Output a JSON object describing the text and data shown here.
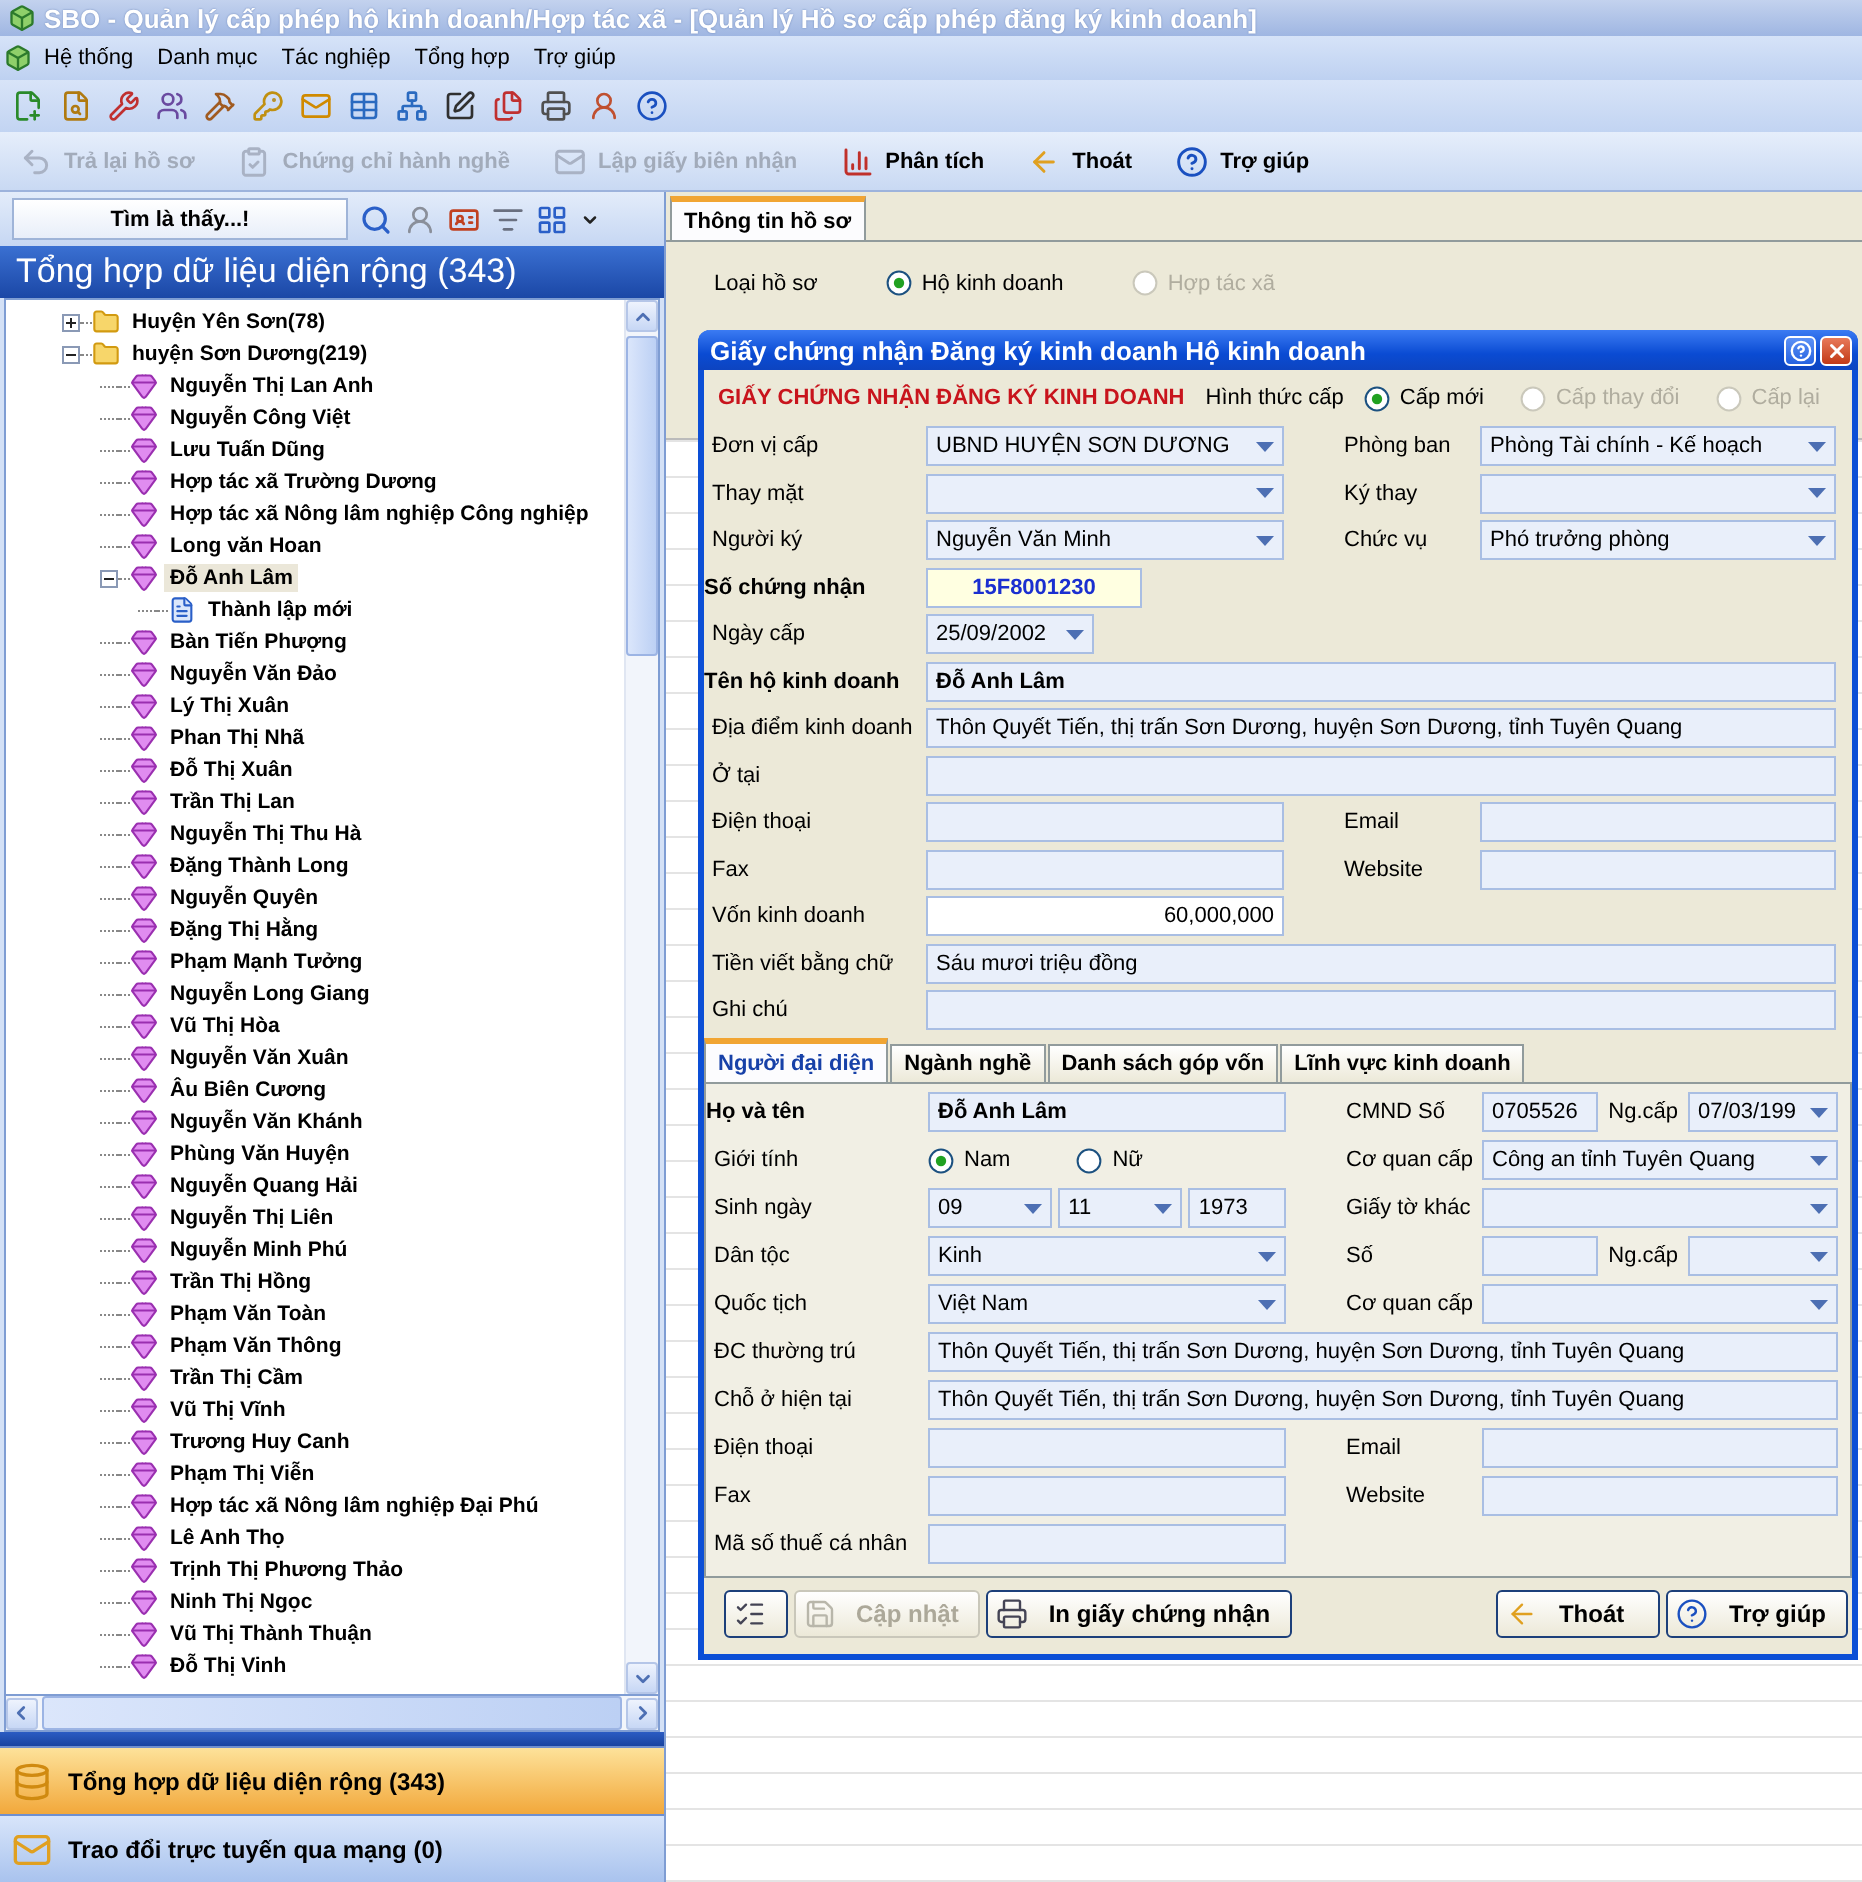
{
  "window": {
    "title": "SBO - Quản lý cấp phép hộ kinh doanh/Hợp tác xã - [Quản lý Hồ sơ cấp phép đăng ký kinh doanh]"
  },
  "menu": [
    "Hệ thống",
    "Danh mục",
    "Tác nghiệp",
    "Tổng hợp",
    "Trợ giúp"
  ],
  "commands": [
    {
      "label": "Trả lại hồ sơ",
      "disabled": true
    },
    {
      "label": "Chứng chỉ hành nghề",
      "disabled": true
    },
    {
      "label": "Lập giấy biên nhận",
      "disabled": true
    },
    {
      "label": "Phân tích",
      "disabled": false
    },
    {
      "label": "Thoát",
      "disabled": false
    },
    {
      "label": "Trợ giúp",
      "disabled": false
    }
  ],
  "sidebar": {
    "search_button": "Tìm là thấy...!",
    "header": "Tổng hợp dữ liệu diện rộng (343)",
    "tree": [
      {
        "label": "Huyện Yên Sơn(78)",
        "kind": "group",
        "selected": false,
        "expanded": false
      },
      {
        "label": "huyện Sơn Dương(219)",
        "kind": "group",
        "selected": false,
        "expanded": true,
        "children": [
          {
            "label": "Nguyễn Thị Lan Anh",
            "kind": "person",
            "selected": false
          },
          {
            "label": "Nguyễn Công Việt",
            "kind": "person",
            "selected": false
          },
          {
            "label": "Lưu Tuấn Dũng",
            "kind": "person",
            "selected": false
          },
          {
            "label": "Hợp tác xã Trường Dương",
            "kind": "person",
            "selected": false
          },
          {
            "label": "Hợp tác xã Nông lâm nghiệp Công nghiệp",
            "kind": "person",
            "selected": false
          },
          {
            "label": "Long văn Hoan",
            "kind": "person",
            "selected": false
          },
          {
            "label": "Đỗ Anh Lâm",
            "kind": "person",
            "selected": true,
            "expanded": true,
            "children": [
              {
                "label": "Thành lập mới",
                "kind": "record",
                "selected": false
              }
            ]
          },
          {
            "label": "Bàn Tiến Phượng",
            "kind": "person",
            "selected": false
          },
          {
            "label": "Nguyễn Văn Đảo",
            "kind": "person",
            "selected": false
          },
          {
            "label": "Lý Thị Xuân",
            "kind": "person",
            "selected": false
          },
          {
            "label": "Phan Thị Nhã",
            "kind": "person",
            "selected": false
          },
          {
            "label": "Đỗ Thị Xuân",
            "kind": "person",
            "selected": false
          },
          {
            "label": "Trần Thị Lan",
            "kind": "person",
            "selected": false
          },
          {
            "label": "Nguyễn Thị Thu Hà",
            "kind": "person",
            "selected": false
          },
          {
            "label": "Đặng Thành Long",
            "kind": "person",
            "selected": false
          },
          {
            "label": "Nguyễn Quyên",
            "kind": "person",
            "selected": false
          },
          {
            "label": "Đặng Thị Hằng",
            "kind": "person",
            "selected": false
          },
          {
            "label": "Phạm Mạnh Tưởng",
            "kind": "person",
            "selected": false
          },
          {
            "label": "Nguyễn Long Giang",
            "kind": "person",
            "selected": false
          },
          {
            "label": "Vũ Thị Hòa",
            "kind": "person",
            "selected": false
          },
          {
            "label": "Nguyễn Văn Xuân",
            "kind": "person",
            "selected": false
          },
          {
            "label": "Âu Biên Cương",
            "kind": "person",
            "selected": false
          },
          {
            "label": "Nguyễn Văn Khánh",
            "kind": "person",
            "selected": false
          },
          {
            "label": "Phùng Văn Huyện",
            "kind": "person",
            "selected": false
          },
          {
            "label": "Nguyễn Quang Hải",
            "kind": "person",
            "selected": false
          },
          {
            "label": "Nguyễn Thị Liên",
            "kind": "person",
            "selected": false
          },
          {
            "label": "Nguyễn Minh Phú",
            "kind": "person",
            "selected": false
          },
          {
            "label": "Trần Thị Hồng",
            "kind": "person",
            "selected": false
          },
          {
            "label": "Phạm Văn Toàn",
            "kind": "person",
            "selected": false
          },
          {
            "label": "Phạm Văn Thông",
            "kind": "person",
            "selected": false
          },
          {
            "label": "Trần Thị Cầm",
            "kind": "person",
            "selected": false
          },
          {
            "label": "Vũ Thị Vĩnh",
            "kind": "person",
            "selected": false
          },
          {
            "label": "Trương Huy Canh",
            "kind": "person",
            "selected": false
          },
          {
            "label": "Phạm Thị Viễn",
            "kind": "person",
            "selected": false
          },
          {
            "label": "Hợp tác xã Nông lâm nghiệp Đại Phú",
            "kind": "person",
            "selected": false
          },
          {
            "label": "Lê Anh Thọ",
            "kind": "person",
            "selected": false
          },
          {
            "label": "Trịnh Thị Phương Thảo",
            "kind": "person",
            "selected": false
          },
          {
            "label": "Ninh Thị Ngọc",
            "kind": "person",
            "selected": false
          },
          {
            "label": "Vũ Thị Thành Thuận",
            "kind": "person",
            "selected": false
          },
          {
            "label": "Đỗ Thị Vinh",
            "kind": "person",
            "selected": false
          }
        ]
      }
    ],
    "nav": [
      {
        "label": "Tổng hợp dữ liệu diện rộng (343)",
        "selected": true
      },
      {
        "label": "Trao đổi trực tuyến qua mạng (0)",
        "selected": false
      }
    ]
  },
  "record": {
    "tabs": [
      {
        "label": "Thông tin hồ sơ",
        "selected": true
      }
    ],
    "type_label": "Loại hồ sơ",
    "type_options": [
      {
        "label": "Hộ kinh doanh",
        "selected": true,
        "disabled": false
      },
      {
        "label": "Hợp tác xã",
        "selected": false,
        "disabled": true
      }
    ]
  },
  "dialog": {
    "title": "Giấy chứng nhận Đăng ký kinh doanh Hộ kinh doanh",
    "heading": "GIẤY CHỨNG NHẬN ĐĂNG KÝ KINH DOANH",
    "issue": {
      "label": "Hình thức cấp",
      "options": [
        {
          "label": "Cấp mới",
          "selected": true,
          "disabled": false
        },
        {
          "label": "Cấp thay đổi",
          "selected": false,
          "disabled": true
        },
        {
          "label": "Cấp lại",
          "selected": false,
          "disabled": true
        }
      ]
    },
    "rows": [
      {
        "kind": "pair",
        "left": {
          "label": "Đơn vị cấp",
          "controls": [
            {
              "kind": "combo",
              "value": "UBND HUYỆN SƠN DƯƠNG"
            }
          ]
        },
        "right": {
          "label": "Phòng ban",
          "controls": [
            {
              "kind": "combo",
              "value": "Phòng Tài chính - Kế hoạch"
            }
          ]
        }
      },
      {
        "kind": "pair",
        "left": {
          "label": "Thay mặt",
          "controls": [
            {
              "kind": "combo"
            }
          ]
        },
        "right": {
          "label": "Ký thay",
          "controls": [
            {
              "kind": "combo"
            }
          ]
        }
      },
      {
        "kind": "pair",
        "left": {
          "label": "Người ký",
          "controls": [
            {
              "kind": "combo",
              "value": "Nguyễn Văn Minh"
            }
          ]
        },
        "right": {
          "label": "Chức vụ",
          "controls": [
            {
              "kind": "combo",
              "value": "Phó trưởng phòng"
            }
          ]
        }
      },
      {
        "kind": "pair",
        "left": {
          "label": "Số chứng nhận",
          "strong": true,
          "controls": [
            {
              "kind": "cert",
              "value": "15F8001230"
            }
          ]
        }
      },
      {
        "kind": "pair",
        "left": {
          "label": "Ngày cấp",
          "controls": [
            {
              "kind": "date",
              "value": "25/09/2002"
            }
          ]
        }
      },
      {
        "kind": "wide",
        "label": "Tên hộ kinh doanh",
        "strong": true,
        "controls": [
          {
            "kind": "text",
            "value": "Đỗ Anh Lâm"
          }
        ]
      },
      {
        "kind": "wide",
        "label": "Địa điểm kinh doanh",
        "controls": [
          {
            "kind": "text",
            "value": "Thôn Quyết Tiến, thị trấn Sơn Dương, huyện Sơn Dương, tỉnh Tuyên Quang"
          }
        ]
      },
      {
        "kind": "wide",
        "label": "Ở tại",
        "controls": [
          {
            "kind": "text"
          }
        ]
      },
      {
        "kind": "pair",
        "left": {
          "label": "Điện thoại",
          "controls": [
            {
              "kind": "text"
            }
          ]
        },
        "right": {
          "label": "Email",
          "controls": [
            {
              "kind": "text"
            }
          ]
        }
      },
      {
        "kind": "pair",
        "left": {
          "label": "Fax",
          "controls": [
            {
              "kind": "text"
            }
          ]
        },
        "right": {
          "label": "Website",
          "controls": [
            {
              "kind": "text"
            }
          ]
        }
      },
      {
        "kind": "pair",
        "left": {
          "label": "Vốn kinh doanh",
          "controls": [
            {
              "kind": "number",
              "value": "60,000,000"
            }
          ]
        }
      },
      {
        "kind": "wide",
        "label": "Tiền viết bằng chữ",
        "controls": [
          {
            "kind": "text",
            "value": "Sáu mươi triệu đồng"
          }
        ]
      },
      {
        "kind": "wide",
        "label": "Ghi chú",
        "controls": [
          {
            "kind": "text"
          }
        ]
      }
    ],
    "tabs": [
      {
        "label": "Người đại diện",
        "selected": true
      },
      {
        "label": "Ngành nghề",
        "selected": false
      },
      {
        "label": "Danh sách góp vốn",
        "selected": false
      },
      {
        "label": "Lĩnh vực kinh doanh",
        "selected": false
      }
    ],
    "rep_rows": [
      {
        "kind": "pair",
        "left": {
          "label": "Họ và tên",
          "strong": true,
          "controls": [
            {
              "kind": "text",
              "value": "Đỗ Anh Lâm"
            }
          ]
        },
        "right": {
          "label": "CMND Số",
          "controls": [
            {
              "kind": "text",
              "value": "0705526"
            },
            {
              "kind": "label",
              "value": "Ng.cấp"
            },
            {
              "kind": "combo",
              "value": "07/03/199"
            }
          ]
        }
      },
      {
        "kind": "pair",
        "left": {
          "label": "Giới tính",
          "controls": [
            {
              "kind": "radio",
              "label": "Nam",
              "selected": true
            },
            {
              "kind": "radio",
              "label": "Nữ",
              "selected": false
            }
          ]
        },
        "right": {
          "label": "Cơ quan cấp",
          "controls": [
            {
              "kind": "combo",
              "value": "Công an tỉnh Tuyên Quang"
            }
          ]
        }
      },
      {
        "kind": "pair",
        "left": {
          "label": "Sinh ngày",
          "controls": [
            {
              "kind": "combo",
              "value": "09"
            },
            {
              "kind": "combo",
              "value": "11"
            },
            {
              "kind": "text",
              "value": "1973"
            }
          ]
        },
        "right": {
          "label": "Giấy tờ khác",
          "controls": [
            {
              "kind": "combo"
            }
          ]
        }
      },
      {
        "kind": "pair",
        "left": {
          "label": "Dân tộc",
          "controls": [
            {
              "kind": "combo",
              "value": "Kinh"
            }
          ]
        },
        "right": {
          "label": "Số",
          "controls": [
            {
              "kind": "text"
            },
            {
              "kind": "label",
              "value": "Ng.cấp"
            },
            {
              "kind": "combo"
            }
          ]
        }
      },
      {
        "kind": "pair",
        "left": {
          "label": "Quốc tịch",
          "controls": [
            {
              "kind": "combo",
              "value": "Việt Nam"
            }
          ]
        },
        "right": {
          "label": "Cơ quan cấp",
          "controls": [
            {
              "kind": "combo"
            }
          ]
        }
      },
      {
        "kind": "wide",
        "label": "ĐC thường trú",
        "controls": [
          {
            "kind": "text",
            "value": "Thôn Quyết Tiến, thị trấn Sơn Dương, huyện Sơn Dương, tỉnh Tuyên Quang"
          }
        ]
      },
      {
        "kind": "wide",
        "label": "Chỗ ở hiện tại",
        "controls": [
          {
            "kind": "text",
            "value": "Thôn Quyết Tiến, thị trấn Sơn Dương, huyện Sơn Dương, tỉnh Tuyên Quang"
          }
        ]
      },
      {
        "kind": "pair",
        "left": {
          "label": "Điện thoại",
          "controls": [
            {
              "kind": "text"
            }
          ]
        },
        "right": {
          "label": "Email",
          "controls": [
            {
              "kind": "text"
            }
          ]
        }
      },
      {
        "kind": "pair",
        "left": {
          "label": "Fax",
          "controls": [
            {
              "kind": "text"
            }
          ]
        },
        "right": {
          "label": "Website",
          "controls": [
            {
              "kind": "text"
            }
          ]
        }
      },
      {
        "kind": "pair",
        "left": {
          "label": "Mã số thuế cá nhân",
          "controls": [
            {
              "kind": "text"
            }
          ]
        }
      }
    ],
    "left_buttons": [
      {
        "kind": "icon",
        "disabled": false
      },
      {
        "kind": "text",
        "label": "Cập nhật",
        "disabled": true
      },
      {
        "kind": "text",
        "label": "In giấy chứng nhận",
        "disabled": false
      }
    ],
    "right_buttons": [
      {
        "kind": "text",
        "label": "Thoát",
        "disabled": false
      },
      {
        "kind": "text",
        "label": "Trợ giúp",
        "disabled": false
      }
    ]
  }
}
